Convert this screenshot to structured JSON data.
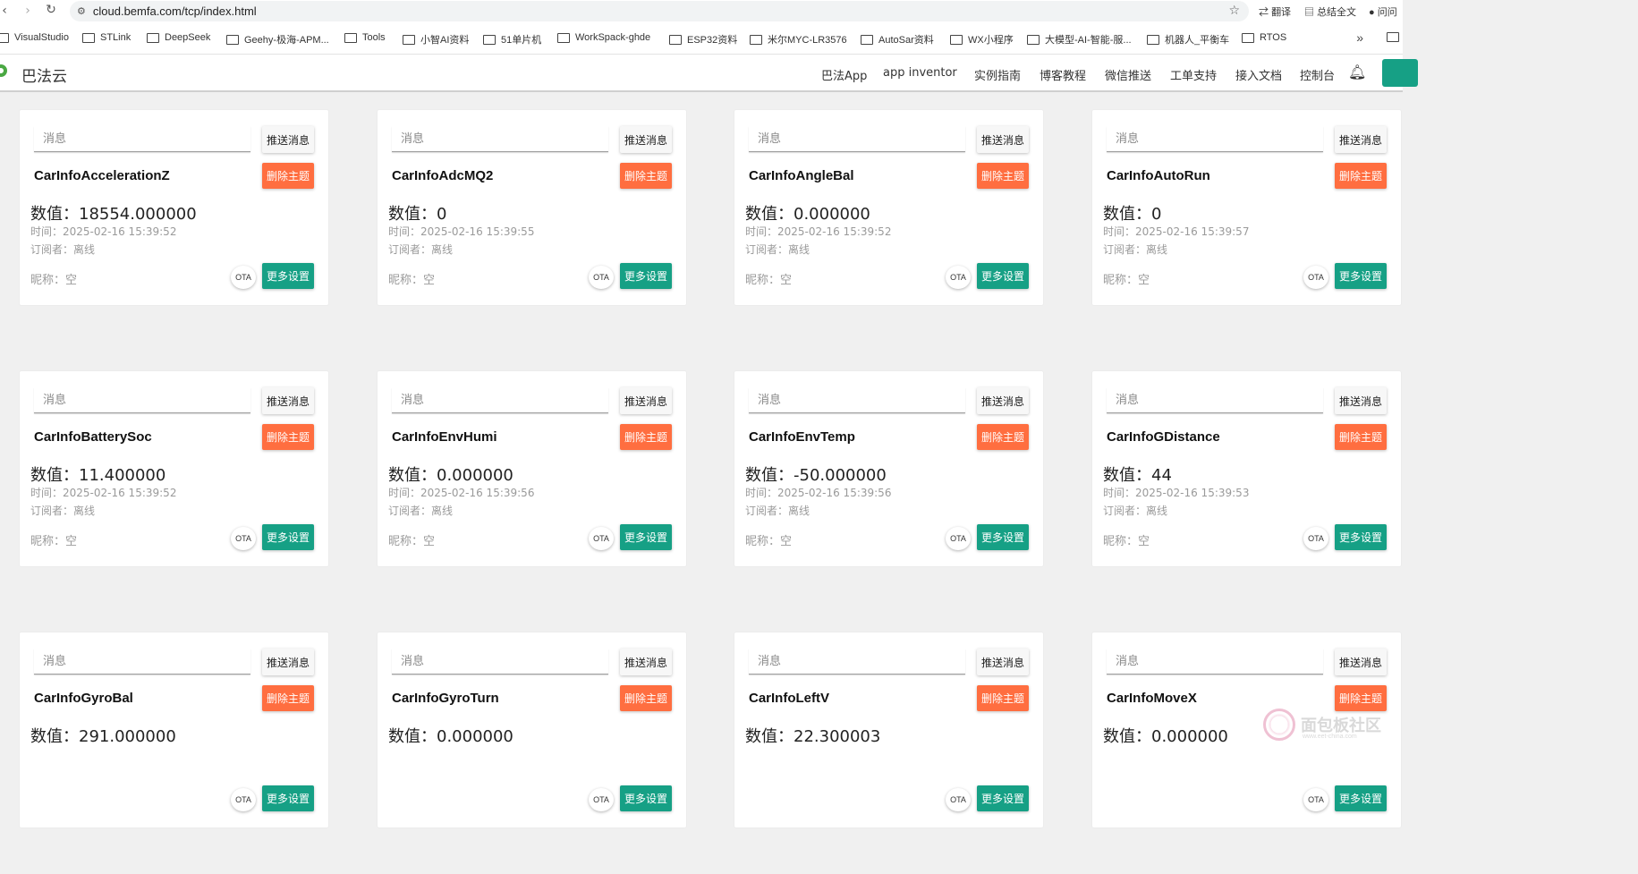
{
  "browser": {
    "url": "cloud.bemfa.com/tcp/index.html",
    "ext_translate": "翻译",
    "ext_summary": "总结全文",
    "ext_user": "问问"
  },
  "bookmarks": [
    "VisualStudio",
    "STLink",
    "DeepSeek",
    "Geehy-极海-APM...",
    "Tools",
    "小智AI资料",
    "51单片机",
    "WorkSpack-ghde",
    "ESP32资料",
    "米尔MYC-LR3576",
    "AutoSar资料",
    "WX小程序",
    "大模型-AI-智能-服...",
    "机器人_平衡车",
    "RTOS"
  ],
  "header": {
    "logo": "巴法云",
    "nav": [
      "巴法App",
      "app inventor",
      "实例指南",
      "博客教程",
      "微信推送",
      "工单支持",
      "接入文档",
      "控制台"
    ]
  },
  "card_labels": {
    "msg_placeholder": "消息",
    "push": "推送消息",
    "delete": "删除主题",
    "ota": "OTA",
    "more": "更多设置"
  },
  "cards": [
    {
      "topic": "CarInfoAccelerationZ",
      "value": "数值：18554.000000",
      "time": "时间：2025-02-16 15:39:52",
      "subscriber": "订阅者：离线",
      "nickname": "昵称：空"
    },
    {
      "topic": "CarInfoAdcMQ2",
      "value": "数值：0",
      "time": "时间：2025-02-16 15:39:55",
      "subscriber": "订阅者：离线",
      "nickname": "昵称：空"
    },
    {
      "topic": "CarInfoAngleBal",
      "value": "数值：0.000000",
      "time": "时间：2025-02-16 15:39:52",
      "subscriber": "订阅者：离线",
      "nickname": "昵称：空"
    },
    {
      "topic": "CarInfoAutoRun",
      "value": "数值：0",
      "time": "时间：2025-02-16 15:39:57",
      "subscriber": "订阅者：离线",
      "nickname": "昵称：空"
    },
    {
      "topic": "CarInfoBatterySoc",
      "value": "数值：11.400000",
      "time": "时间：2025-02-16 15:39:52",
      "subscriber": "订阅者：离线",
      "nickname": "昵称：空"
    },
    {
      "topic": "CarInfoEnvHumi",
      "value": "数值：0.000000",
      "time": "时间：2025-02-16 15:39:56",
      "subscriber": "订阅者：离线",
      "nickname": "昵称：空"
    },
    {
      "topic": "CarInfoEnvTemp",
      "value": "数值：-50.000000",
      "time": "时间：2025-02-16 15:39:56",
      "subscriber": "订阅者：离线",
      "nickname": "昵称：空"
    },
    {
      "topic": "CarInfoGDistance",
      "value": "数值：44",
      "time": "时间：2025-02-16 15:39:53",
      "subscriber": "订阅者：离线",
      "nickname": "昵称：空"
    },
    {
      "topic": "CarInfoGyroBal",
      "value": "数值：291.000000",
      "time": "",
      "subscriber": "",
      "nickname": ""
    },
    {
      "topic": "CarInfoGyroTurn",
      "value": "数值：0.000000",
      "time": "",
      "subscriber": "",
      "nickname": ""
    },
    {
      "topic": "CarInfoLeftV",
      "value": "数值：22.300003",
      "time": "",
      "subscriber": "",
      "nickname": ""
    },
    {
      "topic": "CarInfoMoveX",
      "value": "数值：0.000000",
      "time": "",
      "subscriber": "",
      "nickname": ""
    }
  ],
  "watermark": {
    "text": "面包板社区",
    "sub": "www.eet-china.com"
  }
}
